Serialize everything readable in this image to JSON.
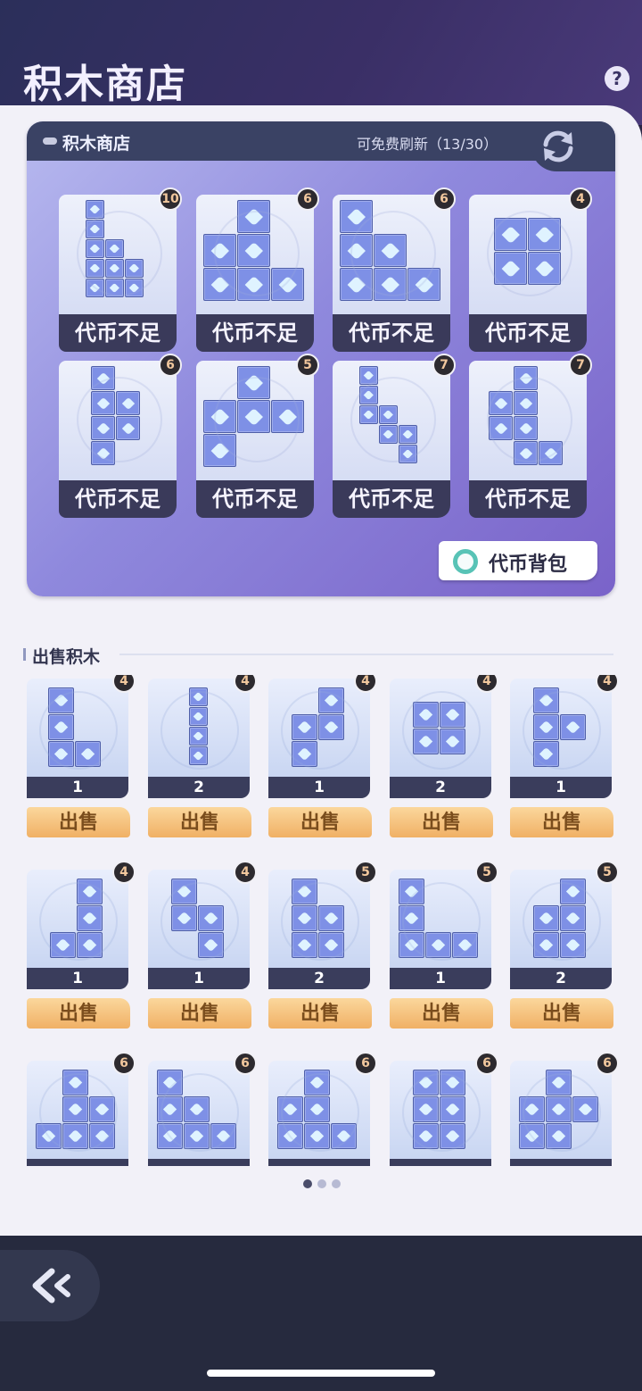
{
  "header": {
    "title": "积木商店",
    "help_label": "?"
  },
  "shop": {
    "title": "积木商店",
    "refresh_text": "可免费刷新（13/30）",
    "items": [
      {
        "price": "10",
        "status": "代币不足"
      },
      {
        "price": "6",
        "status": "代币不足"
      },
      {
        "price": "6",
        "status": "代币不足"
      },
      {
        "price": "4",
        "status": "代币不足"
      },
      {
        "price": "6",
        "status": "代币不足"
      },
      {
        "price": "5",
        "status": "代币不足"
      },
      {
        "price": "7",
        "status": "代币不足"
      },
      {
        "price": "7",
        "status": "代币不足"
      }
    ],
    "token_bag_label": "代币背包"
  },
  "sell": {
    "title": "出售积木",
    "button_label": "出售",
    "items": [
      {
        "price": "4",
        "count": "1"
      },
      {
        "price": "4",
        "count": "2"
      },
      {
        "price": "4",
        "count": "1"
      },
      {
        "price": "4",
        "count": "2"
      },
      {
        "price": "4",
        "count": "1"
      },
      {
        "price": "4",
        "count": "1"
      },
      {
        "price": "4",
        "count": "1"
      },
      {
        "price": "5",
        "count": "2"
      },
      {
        "price": "5",
        "count": "1"
      },
      {
        "price": "5",
        "count": "2"
      },
      {
        "price": "6",
        "count": ""
      },
      {
        "price": "6",
        "count": ""
      },
      {
        "price": "6",
        "count": ""
      },
      {
        "price": "6",
        "count": ""
      },
      {
        "price": "6",
        "count": ""
      }
    ]
  },
  "colors": {
    "accent": "#f0b065",
    "block": "#7e90e6",
    "panel": "#3a4264"
  }
}
